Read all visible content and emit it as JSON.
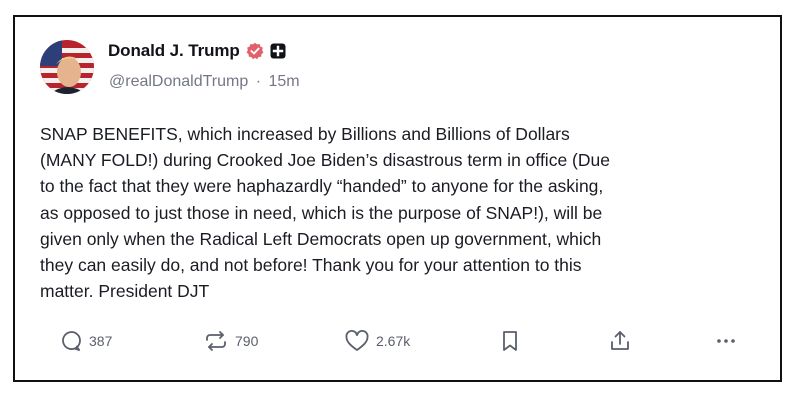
{
  "post": {
    "author_name": "Donald J. Trump",
    "handle": "@realDonaldTrump",
    "separator": "·",
    "time_ago": "15m",
    "text": "SNAP BENEFITS, which increased by Billions and Billions of Dollars\n(MANY FOLD!) during Crooked Joe Biden’s disastrous term in office (Due\nto the fact that they were haphazardly “handed” to anyone for the asking,\nas opposed to just those in need, which is the purpose of SNAP!), will be\ngiven only when the Radical Left Democrats open up government, which\nthey can easily do, and not before! Thank you for your attention to this\nmatter. President DJT"
  },
  "actions": {
    "reply_count": "387",
    "repost_count": "790",
    "like_count": "2.67k"
  },
  "colors": {
    "verified_badge": "#e2606a",
    "icon_gray": "#5b5f6b",
    "handle_gray": "#747886"
  },
  "icons": {
    "verified": "verified-badge-icon",
    "plus": "plus-badge-icon",
    "reply": "reply-icon",
    "repost": "repost-icon",
    "like": "heart-icon",
    "bookmark": "bookmark-icon",
    "share": "share-icon",
    "more": "more-icon"
  }
}
